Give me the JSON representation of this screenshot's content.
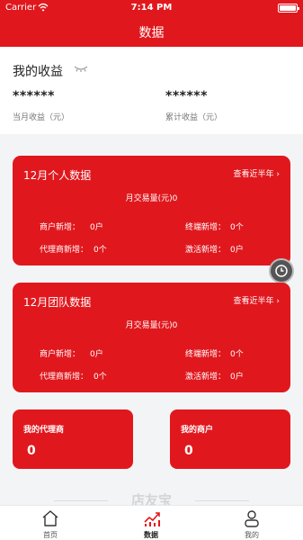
{
  "status_bar": {
    "carrier": "Carrier",
    "time": "7:14 PM"
  },
  "header": {
    "title": "数据"
  },
  "earnings": {
    "title": "我的收益",
    "monthly_value": "******",
    "monthly_label": "当月收益（元）",
    "total_value": "******",
    "total_label": "累计收益（元）"
  },
  "personal_card": {
    "title": "12月个人数据",
    "link": "查看近半年",
    "volume": "月交易量(元)0",
    "stats": [
      {
        "label": "商户新增：",
        "value": "0户"
      },
      {
        "label": "终端新增：",
        "value": "0个"
      },
      {
        "label": "代理商新增：",
        "value": "0个"
      },
      {
        "label": "激活新增：",
        "value": "0户"
      }
    ]
  },
  "team_card": {
    "title": "12月团队数据",
    "link": "查看近半年",
    "volume": "月交易量(元)0",
    "stats": [
      {
        "label": "商户新增：",
        "value": "0户"
      },
      {
        "label": "终端新增：",
        "value": "0个"
      },
      {
        "label": "代理商新增：",
        "value": "0个"
      },
      {
        "label": "激活新增：",
        "value": "0户"
      }
    ]
  },
  "summary": {
    "agents": {
      "title": "我的代理商",
      "value": "0"
    },
    "merchants": {
      "title": "我的商户",
      "value": "0"
    }
  },
  "watermark": "店友宝",
  "tabs": [
    {
      "label": "首页",
      "icon": "home-icon"
    },
    {
      "label": "数据",
      "icon": "chart-icon"
    },
    {
      "label": "我的",
      "icon": "user-icon"
    }
  ],
  "colors": {
    "brand": "#e0181e",
    "background": "#f3f4f6"
  }
}
